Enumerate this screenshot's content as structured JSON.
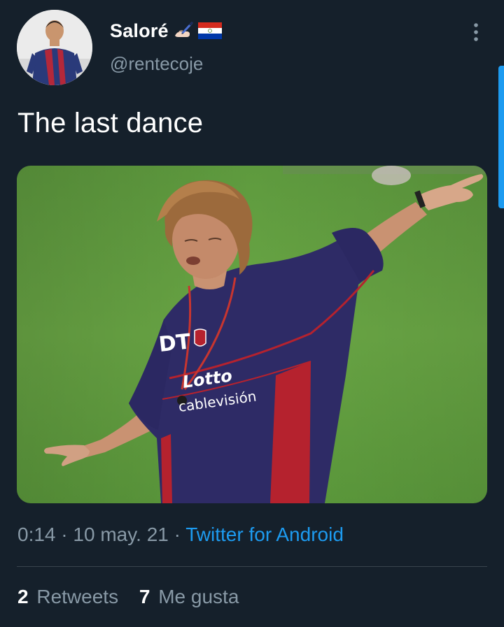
{
  "author": {
    "display_name": "Saloré",
    "handle": "@rentecoje",
    "emoji_1": "writing-hand-icon",
    "emoji_2": "paraguay-flag-icon"
  },
  "tweet": {
    "text": "The last dance",
    "time": "0:14",
    "separator": "·",
    "date": "10 may. 21",
    "source": "Twitter for Android"
  },
  "stats": {
    "retweets_count": "2",
    "retweets_label": "Retweets",
    "likes_count": "7",
    "likes_label": "Me gusta"
  },
  "media": {
    "jersey_initials": "DT",
    "sponsor_1": "Lotto",
    "sponsor_2": "cablevisión"
  },
  "colors": {
    "background": "#15202b",
    "secondary_text": "#8899a6",
    "accent": "#1d9bf0",
    "divider": "#38444d"
  }
}
